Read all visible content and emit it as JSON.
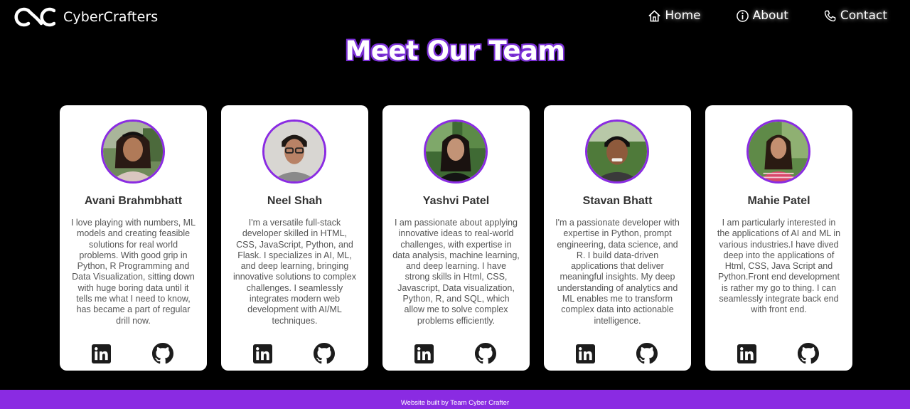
{
  "nav": {
    "brand": "CyberCrafters",
    "links": [
      {
        "label": "Home",
        "icon": "home-icon"
      },
      {
        "label": "About",
        "icon": "info-icon"
      },
      {
        "label": "Contact",
        "icon": "phone-icon"
      }
    ]
  },
  "heading": "Meet Our Team",
  "team": [
    {
      "name": "Avani Brahmbhatt",
      "bio": "I love playing with numbers, ML models and creating feasible solutions for real world problems. With good grip in Python, R Programming and Data Visualization, sitting down with huge boring data until it tells me what I need to know, has became a part of regular drill now.",
      "photo_icon": "avatar-photo"
    },
    {
      "name": "Neel Shah",
      "bio": "I'm a versatile full-stack developer skilled in HTML, CSS, JavaScript, Python, and Flask. I specializes in AI, ML, and deep learning, bringing innovative solutions to complex challenges. I seamlessly integrates modern web development with AI/ML techniques.",
      "photo_icon": "avatar-photo"
    },
    {
      "name": "Yashvi Patel",
      "bio": "I am passionate about applying innovative ideas to real-world challenges, with expertise in data analysis, machine learning, and deep learning. I have strong skills in Html, CSS, Javascript, Data visualization, Python, R, and SQL, which allow me to solve complex problems efficiently.",
      "photo_icon": "avatar-photo"
    },
    {
      "name": "Stavan Bhatt",
      "bio": "I'm a passionate developer with expertise in Python, prompt engineering, data science, and R. I build data-driven applications that deliver meaningful insights. My deep understanding of analytics and ML enables me to transform complex data into actionable intelligence.",
      "photo_icon": "avatar-photo"
    },
    {
      "name": "Mahie Patel",
      "bio": "I am particularly interested in the applications of AI and ML in various industries.I have dived deep into the applications of Html, CSS, Java Script and Python.Front end development is rather my go to thing. I can seamlessly integrate back end with front end.",
      "photo_icon": "avatar-photo"
    }
  ],
  "social_icons": [
    "linkedin-icon",
    "github-icon"
  ],
  "footer": "Website built by Team Cyber Crafter",
  "colors": {
    "background": "#000000",
    "accent": "#8a2be2",
    "card": "#ffffff",
    "text_dark": "#333333",
    "text_body": "#555555"
  }
}
